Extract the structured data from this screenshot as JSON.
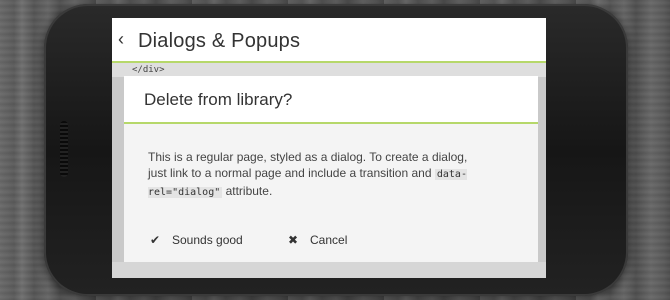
{
  "header": {
    "back_icon": "chevron-left-icon",
    "title": "Dialogs & Popups"
  },
  "background_code": "</div>",
  "dialog": {
    "title": "Delete from library?",
    "body_text_1": "This is a regular page, styled as a dialog. To create a dialog, just link to a normal page and include a transition and ",
    "body_code": "data-rel=\"dialog\"",
    "body_text_2": " attribute.",
    "ok_label": "Sounds good",
    "ok_icon": "check-icon",
    "cancel_label": "Cancel",
    "cancel_icon": "close-icon"
  },
  "colors": {
    "accent": "#b6d86a",
    "phone_body": "#1c1c1c",
    "dialog_bg": "#f4f4f4"
  }
}
